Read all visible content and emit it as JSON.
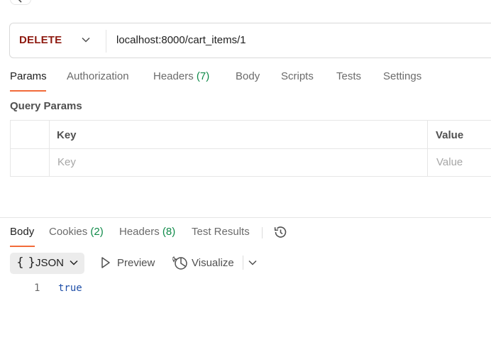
{
  "request": {
    "method": "DELETE",
    "url": "localhost:8000/cart_items/1"
  },
  "request_tabs": [
    {
      "label": "Params",
      "count": ""
    },
    {
      "label": "Authorization",
      "count": ""
    },
    {
      "label": "Headers",
      "count": "(7)"
    },
    {
      "label": "Body",
      "count": ""
    },
    {
      "label": "Scripts",
      "count": ""
    },
    {
      "label": "Tests",
      "count": ""
    },
    {
      "label": "Settings",
      "count": ""
    }
  ],
  "query_params": {
    "title": "Query Params",
    "headers": {
      "key": "Key",
      "value": "Value"
    },
    "placeholders": {
      "key": "Key",
      "value": "Value"
    }
  },
  "response_tabs": [
    {
      "label": "Body",
      "count": ""
    },
    {
      "label": "Cookies",
      "count": "(2)"
    },
    {
      "label": "Headers",
      "count": "(8)"
    },
    {
      "label": "Test Results",
      "count": ""
    }
  ],
  "response_toolbar": {
    "format_braces": "{ }",
    "format": "JSON",
    "preview": "Preview",
    "visualize": "Visualize"
  },
  "response_body": {
    "line_number": "1",
    "value": "true"
  },
  "colors": {
    "method": "#8e1a10",
    "accent": "#f26b3a",
    "count": "#0f8a49",
    "json_value": "#1f4fa8"
  }
}
